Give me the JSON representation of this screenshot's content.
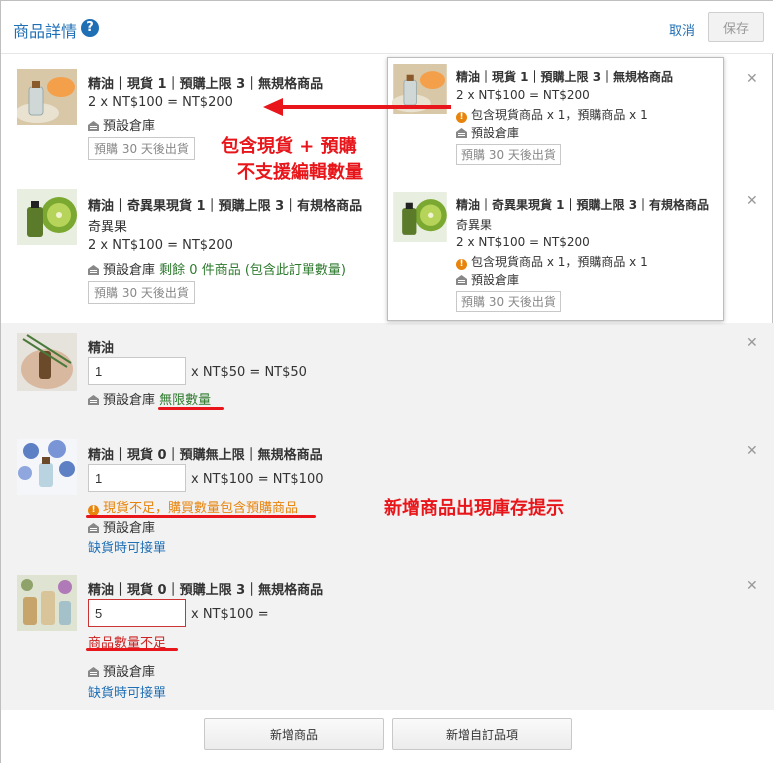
{
  "header": {
    "title": "商品詳情",
    "cancel": "取消",
    "save": "保存"
  },
  "items": [
    {
      "name": "精油｜現貨 1｜預購上限 3｜無規格商品",
      "price_line": "2 x NT$100 = NT$200",
      "warehouse": "預設倉庫",
      "tag": "預購 30 天後出貨"
    },
    {
      "name": "精油｜奇異果現貨 1｜預購上限 3｜有規格商品",
      "variant": "奇異果",
      "price_line": "2 x NT$100 = NT$200",
      "warehouse": "預設倉庫",
      "stock_note": "剩餘 0 件商品 (包含此訂單數量)",
      "tag": "預購 30 天後出貨"
    },
    {
      "name": "精油",
      "qty": "1",
      "price": "x NT$50 = NT$50",
      "warehouse": "預設倉庫",
      "stock_note": "無限數量"
    },
    {
      "name": "精油｜現貨 0｜預購無上限｜無規格商品",
      "qty": "1",
      "price": "x NT$100 = NT$100",
      "warning": "現貨不足，購買數量包含預購商品",
      "warehouse": "預設倉庫",
      "link": "缺貨時可接單"
    },
    {
      "name": "精油｜現貨 0｜預購上限 3｜無規格商品",
      "qty": "5",
      "price": "x NT$100 =",
      "error": "商品數量不足",
      "warehouse": "預設倉庫",
      "link": "缺貨時可接單"
    }
  ],
  "popup": {
    "items": [
      {
        "name": "精油｜現貨 1｜預購上限 3｜無規格商品",
        "price_line": "2 x NT$100 = NT$200",
        "warning": "包含現貨商品 x 1，預購商品 x 1",
        "warehouse": "預設倉庫",
        "tag": "預購 30 天後出貨"
      },
      {
        "name": "精油｜奇異果現貨 1｜預購上限 3｜有規格商品",
        "variant": "奇異果",
        "price_line": "2 x NT$100 = NT$200",
        "warning": "包含現貨商品 x 1，預購商品 x 1",
        "warehouse": "預設倉庫",
        "tag": "預購 30 天後出貨"
      }
    ]
  },
  "annotations": {
    "note1_line1": "包含現貨 + 預購",
    "note1_line2": "不支援編輯數量",
    "note2": "新增商品出現庫存提示"
  },
  "footer": {
    "add_product": "新增商品",
    "add_custom": "新增自訂品項"
  },
  "icons": {
    "close": "close-icon",
    "warehouse": "warehouse-icon",
    "help": "help-icon",
    "warning": "warning-icon"
  },
  "colors": {
    "link_blue": "#1f6fb5",
    "stock_green": "#2d7a2d",
    "warning_orange": "#e8840c",
    "error_red": "#c22222",
    "annotation_red": "#e8161a"
  }
}
